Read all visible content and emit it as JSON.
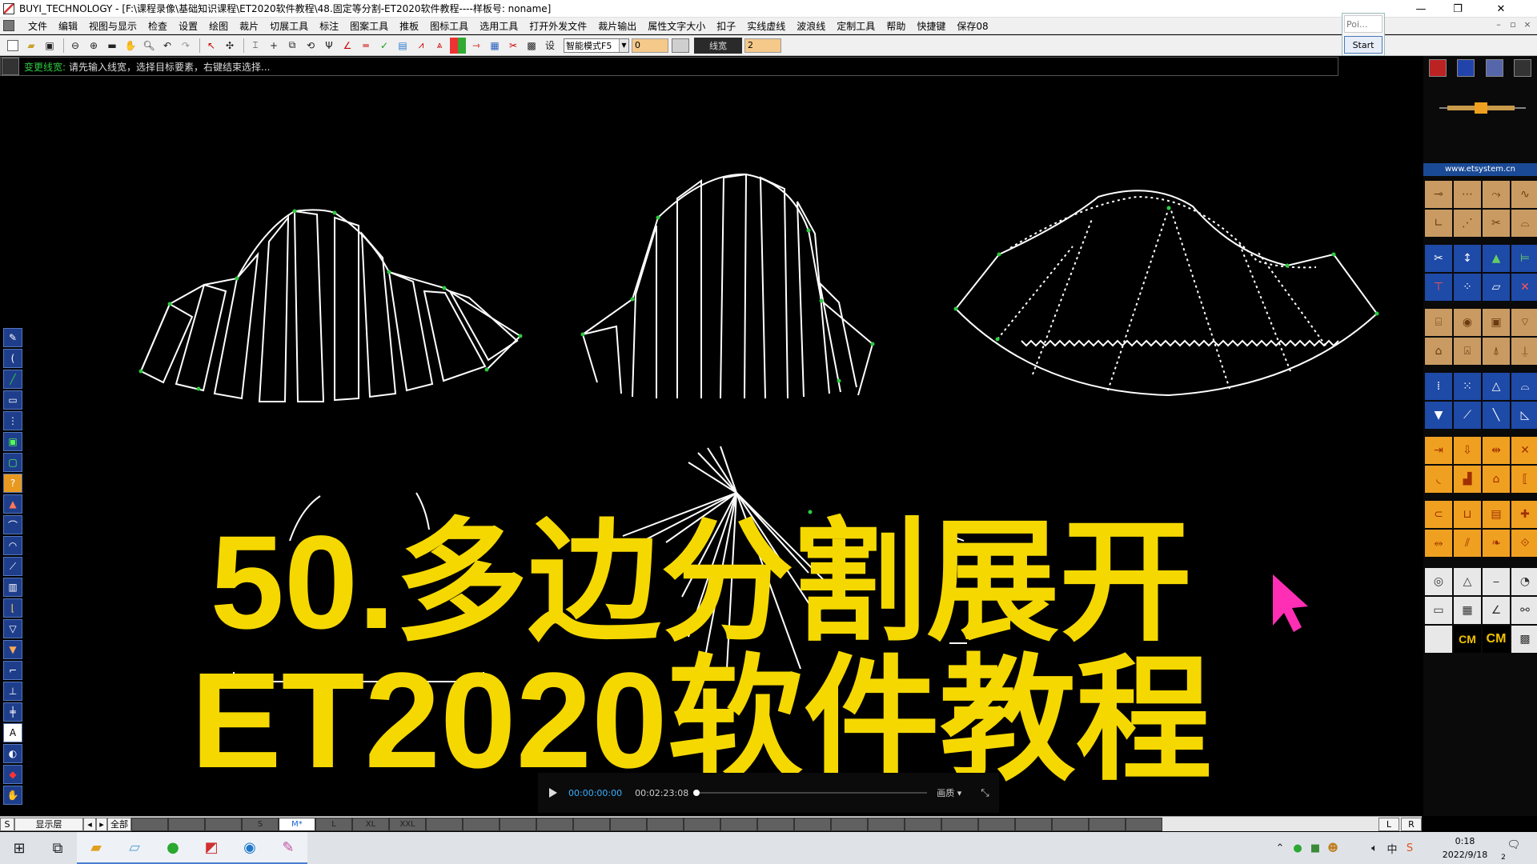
{
  "window": {
    "title": "BUYI_TECHNOLOGY - [F:\\课程录像\\基础知识课程\\ET2020软件教程\\48.固定等分割-ET2020软件教程----样板号: noname]",
    "min": "—",
    "max": "❐",
    "close": "✕"
  },
  "menu": [
    "文件",
    "编辑",
    "视图与显示",
    "检查",
    "设置",
    "绘图",
    "裁片",
    "切展工具",
    "标注",
    "图案工具",
    "推板",
    "图标工具",
    "选用工具",
    "打开外发文件",
    "裁片输出",
    "属性文字大小",
    "扣子",
    "实线虚线",
    "波浪线",
    "定制工具",
    "帮助",
    "快捷键",
    "保存08"
  ],
  "toolbar": {
    "mode_select": "智能模式F5",
    "field1": "0",
    "linewidth_label": "线宽",
    "linewidth_value": "2"
  },
  "poi": {
    "input": "Poi...",
    "start": "Start"
  },
  "status": {
    "command": "变更线宽:",
    "message": "请先输入线宽，选择目标要素，右键结束选择..."
  },
  "overlay": {
    "line1": "50.多边分割展开",
    "line2": "ET2020软件教程"
  },
  "player": {
    "current": "00:00:00:00",
    "total": "00:02:23:08",
    "quality": "画质 ▾",
    "progress": 0
  },
  "sizebar": {
    "s_label": "S",
    "layer": "显示层",
    "all": "全部",
    "sizes": [
      "",
      "",
      "",
      "S",
      "M*",
      "L",
      "XL",
      "XXL"
    ],
    "left": "L",
    "right": "R"
  },
  "right_panel": {
    "url": "www.etsystem.cn",
    "cm": "CM",
    "ruler_label": "CM"
  },
  "taskbar": {
    "time": "0:18",
    "date": "2022/9/18",
    "notifications": "2"
  },
  "colors": {
    "title_yellow": "#f5d800",
    "pattern_line": "#ffffff",
    "point_marker": "#2ecc40",
    "cursor": "#ff2fb5"
  }
}
